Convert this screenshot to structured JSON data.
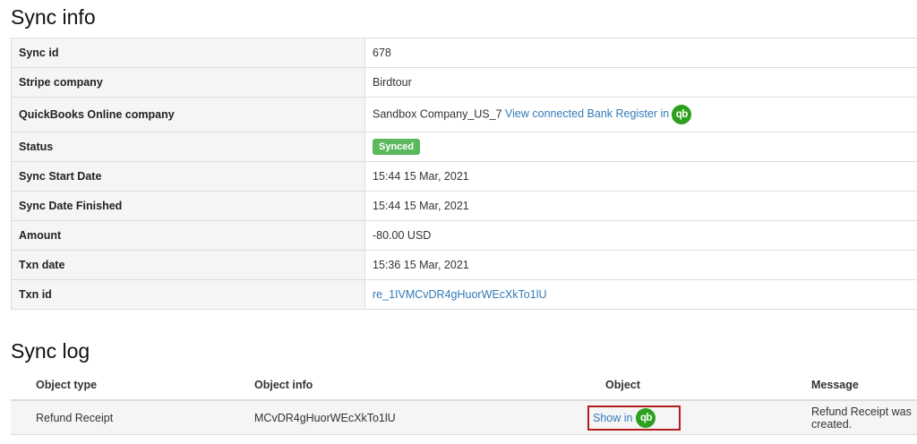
{
  "sync_info": {
    "title": "Sync info",
    "rows": {
      "sync_id": {
        "label": "Sync id",
        "value": "678"
      },
      "stripe_company": {
        "label": "Stripe company",
        "value": "Birdtour"
      },
      "qbo_company": {
        "label": "QuickBooks Online company",
        "value": "Sandbox Company_US_7",
        "link": "View connected Bank Register in",
        "icon": "quickbooks-icon"
      },
      "status": {
        "label": "Status",
        "value": "Synced",
        "color": "#5cb85c"
      },
      "sync_start": {
        "label": "Sync Start Date",
        "value": "15:44 15 Mar, 2021"
      },
      "sync_finished": {
        "label": "Sync Date Finished",
        "value": "15:44 15 Mar, 2021"
      },
      "amount": {
        "label": "Amount",
        "value": "-80.00 USD"
      },
      "txn_date": {
        "label": "Txn date",
        "value": "15:36 15 Mar, 2021"
      },
      "txn_id": {
        "label": "Txn id",
        "value": "re_1IVMCvDR4gHuorWEcXkTo1lU"
      }
    }
  },
  "sync_log": {
    "title": "Sync log",
    "headers": {
      "object_type": "Object type",
      "object_info": "Object info",
      "object": "Object",
      "message": "Message"
    },
    "rows": [
      {
        "object_type": "Refund Receipt",
        "object_info": "MCvDR4gHuorWEcXkTo1lU",
        "object_link": "Show in",
        "object_icon": "quickbooks-icon",
        "message": "Refund Receipt was created."
      }
    ]
  },
  "qb_icon_text": "qb",
  "colors": {
    "accent": "#2ca01c",
    "link": "#337ab7",
    "highlight": "#b51d1d"
  }
}
